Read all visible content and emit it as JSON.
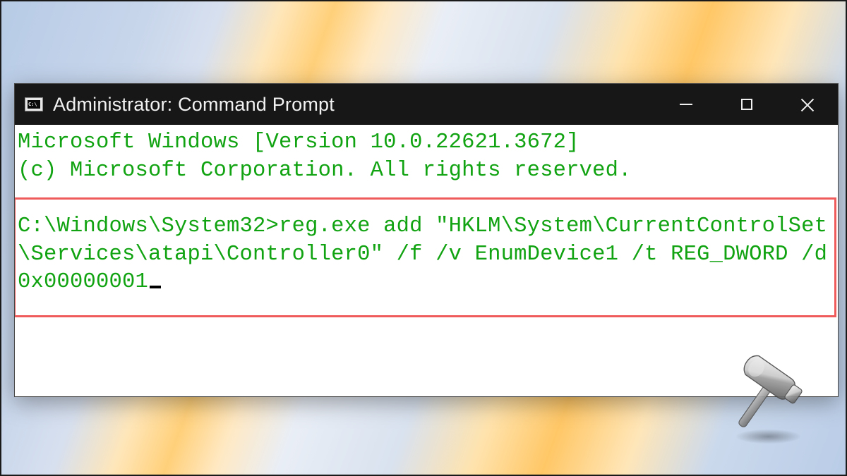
{
  "window": {
    "title": "Administrator: Command Prompt"
  },
  "terminal": {
    "line1": "Microsoft Windows [Version 10.0.22621.3672]",
    "line2": "(c) Microsoft Corporation. All rights reserved.",
    "blank": "",
    "prompt": "C:\\Windows\\System32>",
    "command": "reg.exe add \"HKLM\\System\\CurrentControlSet\\Services\\atapi\\Controller0\" /f /v EnumDevice1 /t REG_DWORD /d 0x00000001"
  },
  "colors": {
    "terminal_text": "#11a311",
    "titlebar_bg": "#171717",
    "highlight": "#ef5b5b"
  },
  "icons": {
    "app": "cmd-icon",
    "minimize": "minimize-icon",
    "maximize": "maximize-icon",
    "close": "close-icon",
    "watermark": "hammer-icon"
  }
}
